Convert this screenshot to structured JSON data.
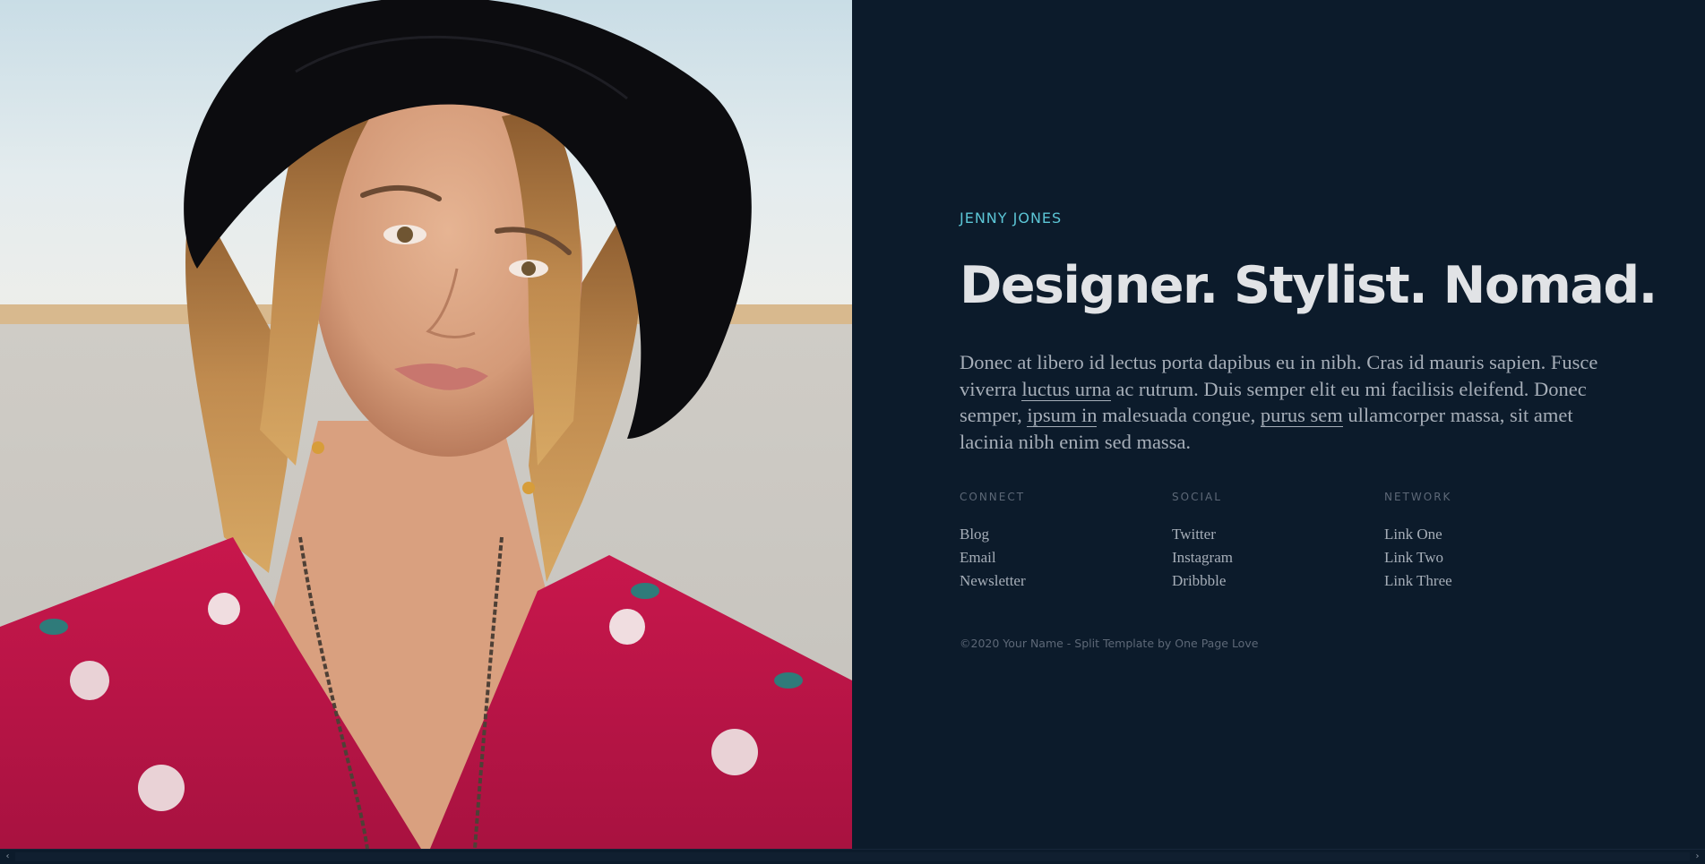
{
  "hero": {
    "photo_alt": "Portrait of a woman wearing a black hat and red floral dress"
  },
  "profile": {
    "name": "JENNY JONES",
    "headline": "Designer. Stylist. Nomad.",
    "intro": {
      "part1": "Donec at libero id lectus porta dapibus eu in nibh. Cras id mauris sapien. Fusce viverra ",
      "link1": "luctus urna",
      "part2": " ac rutrum. Duis semper elit eu mi facilisis eleifend. Donec semper, ",
      "link2": "ipsum in",
      "part3": " malesuada congue, ",
      "link3": "purus sem",
      "part4": " ullamcorper massa, sit amet lacinia nibh enim sed massa."
    }
  },
  "link_columns": [
    {
      "title": "CONNECT",
      "items": [
        "Blog",
        "Email",
        "Newsletter"
      ]
    },
    {
      "title": "SOCIAL",
      "items": [
        "Twitter",
        "Instagram",
        "Dribbble"
      ]
    },
    {
      "title": "NETWORK",
      "items": [
        "Link One",
        "Link Two",
        "Link Three"
      ]
    }
  ],
  "footer": {
    "credit": "©2020 Your Name - Split Template by One Page Love"
  },
  "scrollbar": {
    "left_arrow": "‹",
    "right_arrow": "›"
  },
  "colors": {
    "panel_bg": "#0c1b2b",
    "accent": "#5cc6d6",
    "headline": "#e1e3e6",
    "body_text": "#a6aeb8",
    "muted": "#5d6877"
  }
}
